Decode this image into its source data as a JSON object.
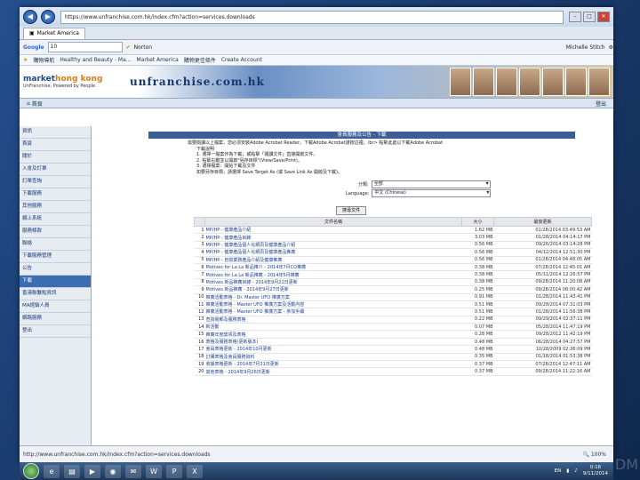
{
  "browser": {
    "address_url": "https://www.unfranchise.com.hk/index.cfm?action=services.downloads",
    "tab_label": "Market America",
    "google_query": "10",
    "norton_label": "Norton",
    "user_name": "Michelle Stitch",
    "favorites": [
      "購物導航",
      "Healthy and Beauty - Ma...",
      "Market America",
      "購物更佳條件",
      "Create Account"
    ]
  },
  "banner": {
    "logo_market": "market",
    "logo_hongkong": "hong kong",
    "logo_tagline": "UnFranchise, Powered by People.",
    "site_title": "unfranchise.com.hk"
  },
  "breadcrumb": {
    "home_label": "首頁",
    "logout_label": "登出"
  },
  "sidebar": {
    "items": [
      {
        "label": "資訊",
        "active": false
      },
      {
        "label": "首頁",
        "active": false
      },
      {
        "label": "關於",
        "active": false
      },
      {
        "label": "入會及訂單",
        "active": false
      },
      {
        "label": "訂單查詢",
        "active": false
      },
      {
        "label": "下載服務",
        "active": false
      },
      {
        "label": "其他服務",
        "active": false
      },
      {
        "label": "網上系統",
        "active": false
      },
      {
        "label": "服務條款",
        "active": false
      },
      {
        "label": "聯絡",
        "active": false
      },
      {
        "label": "下載服務管理",
        "active": false
      },
      {
        "label": "公告",
        "active": false
      },
      {
        "label": "下載",
        "active": true
      },
      {
        "label": "香港聯繫點資訊",
        "active": false
      },
      {
        "label": "MA經銷人員",
        "active": false
      },
      {
        "label": "網路服務",
        "active": false
      },
      {
        "label": "登出",
        "active": false
      }
    ]
  },
  "page": {
    "header": "會員服務及公告 - 下載",
    "instructions": [
      "需要閱讀以上檔案，您必須安裝Adobe Acrobat Reader。下載Adobe Acrobat請按這裡。/br> 點擊此處以下載Adobe Acrobat",
      "下載說明",
      "1. 選擇一檔案作為下載；或點擊「閱讀文件」直接開啟文件。",
      "2. 點擊右鍵並以開啟\"另存目標\"(View/Save/Print)。",
      "3. 選擇檔案：開始下載及文件",
      "   如要另存目標，請選擇 Save Target As (或 Save Link As 開啟及下載)。"
    ],
    "category_label": "分類:",
    "category_value": "全部",
    "language_label": "Language:",
    "language_value": "中文 (Chinese)",
    "search_button": "搜尋文件"
  },
  "table": {
    "headers": {
      "name": "文件名稱",
      "size": "大小",
      "date": "最後更新"
    },
    "rows": [
      {
        "n": "1",
        "name": "MP/HP - 健康產品介紹",
        "size": "1.62 MB",
        "date": "01/28/2014 03:49:53 AM"
      },
      {
        "n": "2",
        "name": "MP/HP - 健康產品目錄",
        "size": "3.03 MB",
        "date": "01/28/2014 04:14:17 PM"
      },
      {
        "n": "3",
        "name": "MP/HP - 健康產品個人化網頁及健康產品介紹",
        "size": "0.56 MB",
        "date": "09/26/2014 03:14:28 PM"
      },
      {
        "n": "4",
        "name": "MP/HP - 健康產品個人化網頁及健康產品推廣",
        "size": "0.56 MB",
        "date": "04/12/2014 12:51:30 PM"
      },
      {
        "n": "5",
        "name": "MP/HP - 自營業務產品介紹及健康推廣",
        "size": "0.56 MB",
        "date": "01/28/2014 04:48:05 AM"
      },
      {
        "n": "6",
        "name": "Motives for La La 新品推介 - 2014年7月CQ推薦",
        "size": "0.38 MB",
        "date": "07/28/2014 12:45:01 AM"
      },
      {
        "n": "7",
        "name": "Motives for La La 新品推薦 - 2014年5月推薦",
        "size": "0.38 MB",
        "date": "05/11/2014 12:26:57 PM"
      },
      {
        "n": "8",
        "name": "Motives 新品推薦目錄 - 2014年9月21日更新",
        "size": "0.38 MB",
        "date": "09/28/2014 11:20:08 AM"
      },
      {
        "n": "9",
        "name": "Motives 新品推薦 - 2014年9月27日更新",
        "size": "0.25 MB",
        "date": "09/28/2014 08:00:42 AM"
      },
      {
        "n": "10",
        "name": "推廣活動表格 - Dr. Master UFO 推廣方案",
        "size": "0.91 MB",
        "date": "01/28/2014 11:43:41 PM"
      },
      {
        "n": "11",
        "name": "推廣活動表格 - Master UFO 推廣方案及活動內容",
        "size": "0.51 MB",
        "date": "09/28/2014 07:31:03 PM"
      },
      {
        "n": "12",
        "name": "推廣活動表格 - Master UFO 推廣方案 - 參加手續",
        "size": "0.51 MB",
        "date": "01/28/2014 11:56:38 PM"
      },
      {
        "n": "13",
        "name": "查詢電郵及服務表格",
        "size": "0.22 MB",
        "date": "09/29/2014 02:37:11 PM"
      },
      {
        "n": "14",
        "name": "新活動",
        "size": "0.07 MB",
        "date": "05/28/2014 11:47:19 PM"
      },
      {
        "n": "15",
        "name": "推廣年度獎項及表格",
        "size": "0.28 MB",
        "date": "09/28/2012 11:42:19 PM"
      },
      {
        "n": "16",
        "name": "表格及服務表格(更新版本)",
        "size": "0.48 MB",
        "date": "06/28/2014 04:27:57 PM"
      },
      {
        "n": "17",
        "name": "會員表格更新 - 2014年10月更新",
        "size": "0.48 MB",
        "date": "10/28/2009 02:36:09 PM"
      },
      {
        "n": "18",
        "name": "訂購表格及會員服務資料",
        "size": "0.35 MB",
        "date": "01/18/2014 01:53:38 PM"
      },
      {
        "n": "19",
        "name": "收據表格更新 - 2014年7月31日更新",
        "size": "0.37 MB",
        "date": "07/28/2014 12:47:11 AM"
      },
      {
        "n": "20",
        "name": "其他表格 - 2014年9月26日更新",
        "size": "0.37 MB",
        "date": "09/28/2014 11:22:16 AM"
      }
    ]
  },
  "status": {
    "url": "http://www.unfranchise.com.hk/index.cfm?action=services.downloads",
    "zoom": "100%"
  },
  "taskbar": {
    "lang": "EN",
    "time": "0:16",
    "date": "9/11/2014"
  },
  "watermark": "DM"
}
